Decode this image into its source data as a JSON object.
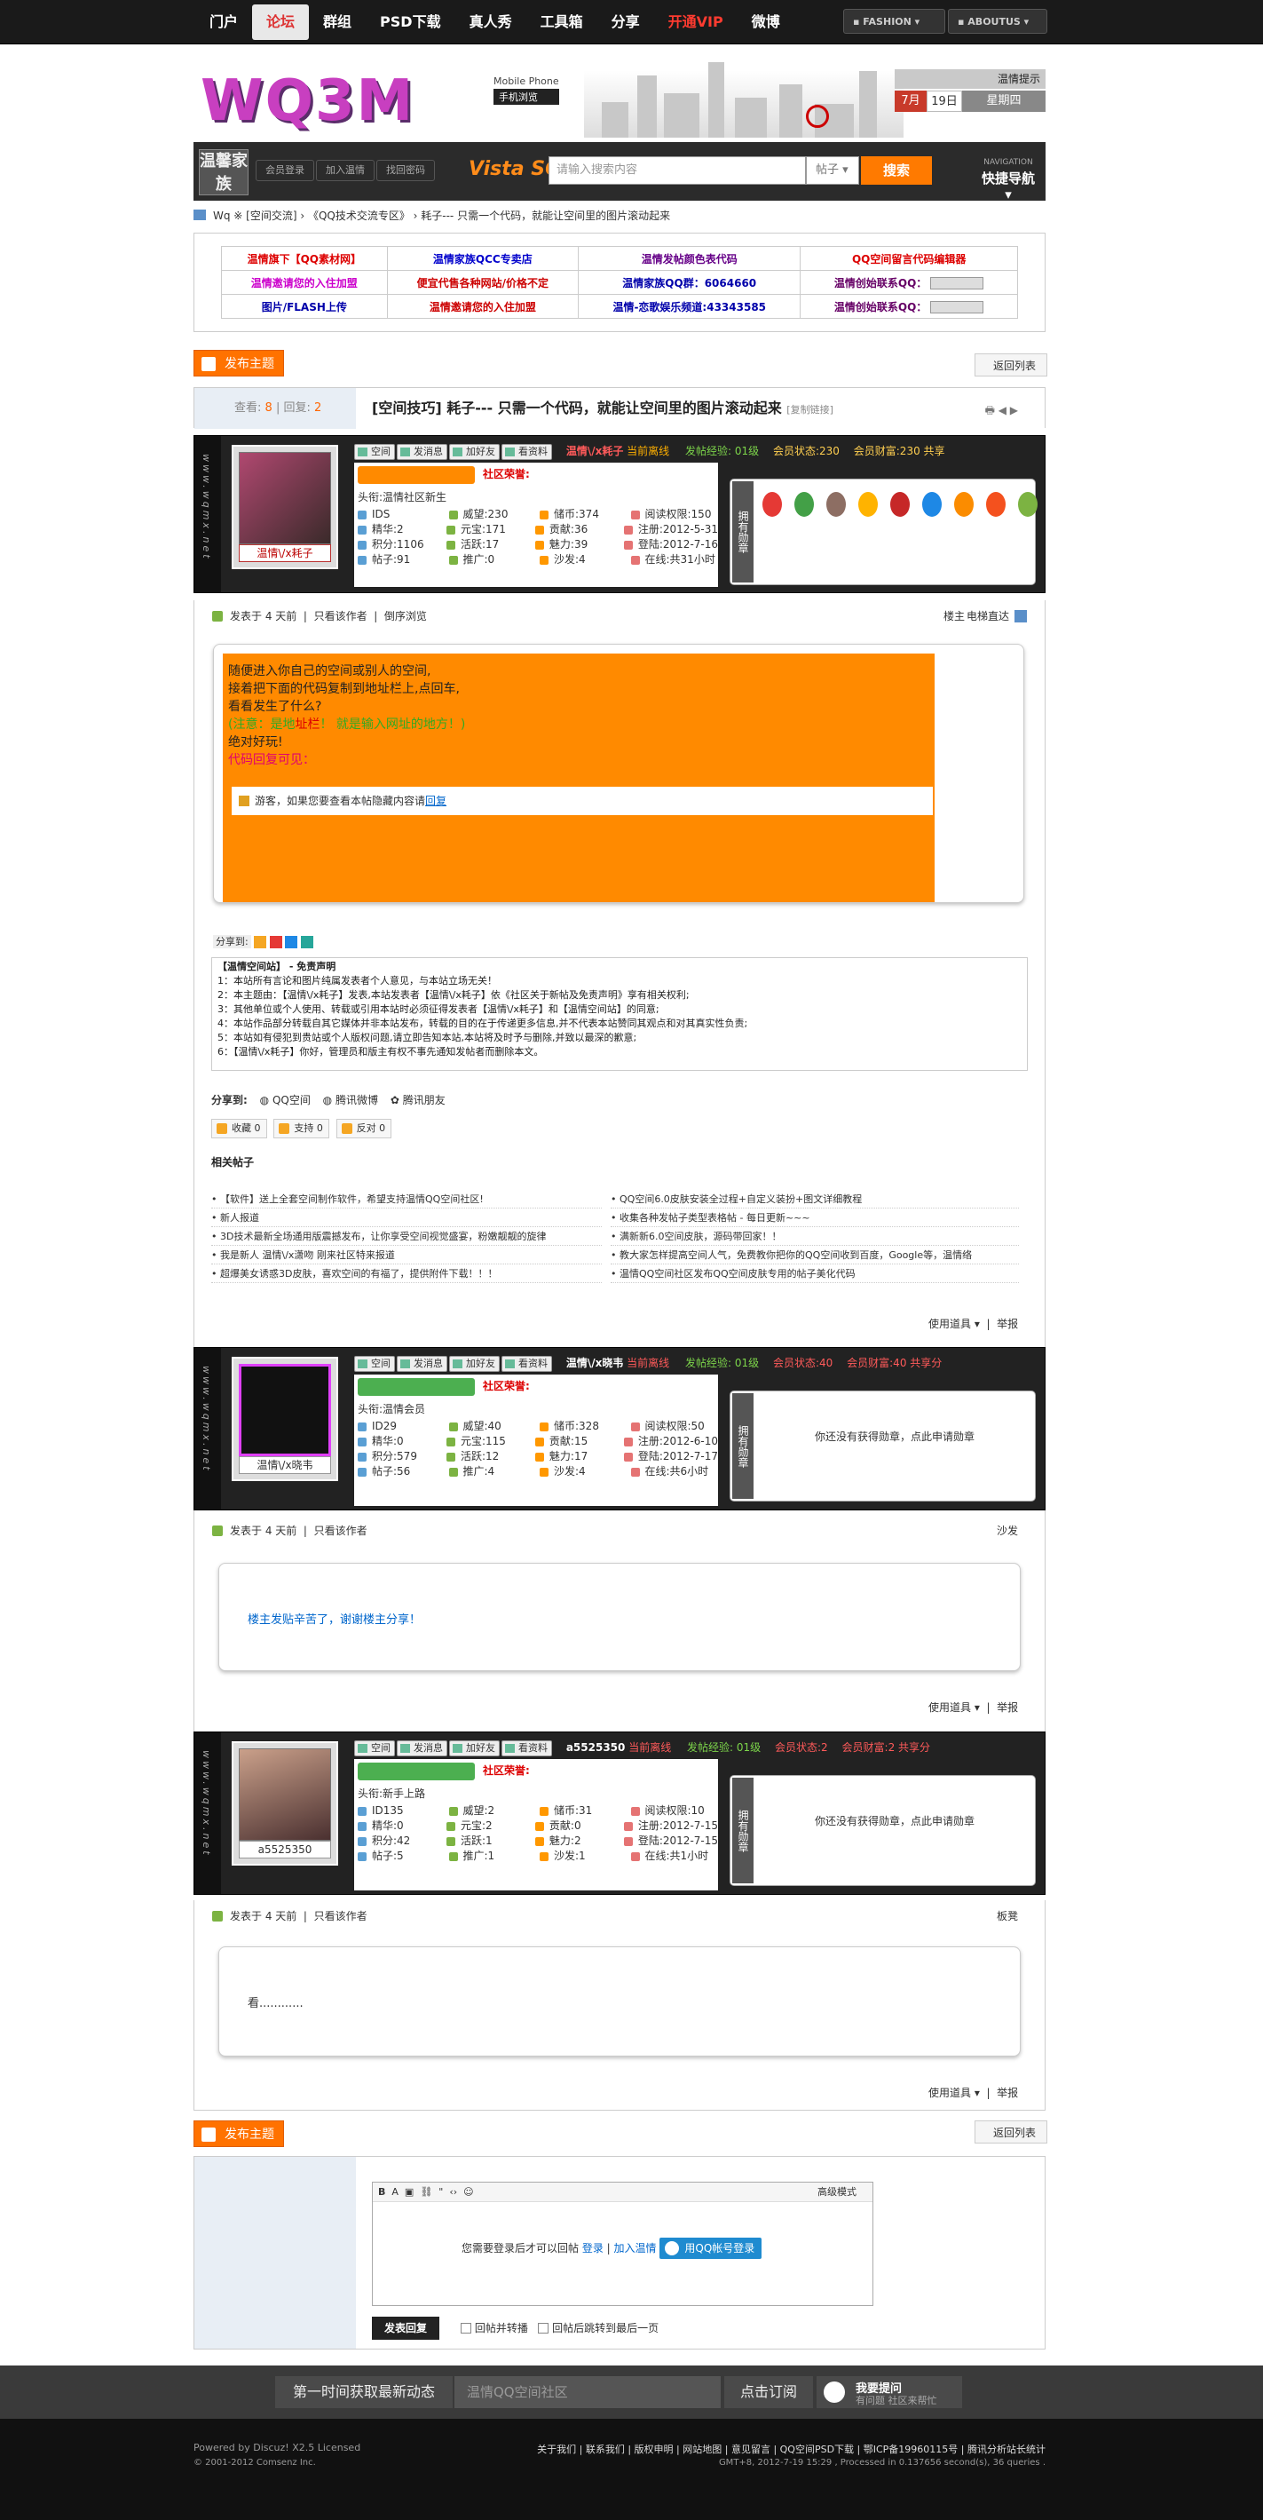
{
  "topnav": {
    "items": [
      "门户",
      "论坛",
      "群组",
      "PSD下载",
      "真人秀",
      "工具箱",
      "分享",
      "开通VIP",
      "微博"
    ],
    "fashion": "FASHION",
    "aboutus": "ABOUTUS"
  },
  "header": {
    "logo": "WQ3M",
    "mobile_en": "Mobile Phone",
    "mobile_cn": "手机浏览",
    "welcome": "温情提示",
    "month": "7月",
    "day": "19日",
    "weekday": "星期四"
  },
  "searchbar": {
    "avatar_text": "温馨家族",
    "login": "会员登录",
    "join": "加入温情",
    "recover": "找回密码",
    "brand": "Vista SO",
    "placeholder": "请输入搜索内容",
    "select": "帖子",
    "go": "搜索",
    "nav_en": "NAVIGATION",
    "nav_cn": "快捷导航"
  },
  "breadcrumb": "Wq ※ [空间交流] › 《QQ技术交流专区》 › 耗子--- 只需一个代码，就能让空间里的图片滚动起来",
  "ads": [
    [
      "温情旗下【QQ素材网】",
      "温情家族QCC专卖店",
      "温情发帖颜色表代码",
      "QQ空间留言代码编辑器"
    ],
    [
      "温情邀请您的入住加盟",
      "便宜代售各种网站/价格不定",
      "温情家族QQ群：6064660",
      "温情创始联系QQ："
    ],
    [
      "图片/FLASH上传",
      "温情邀请您的入住加盟",
      "温情-恋歌娱乐频道:43343585",
      "温情创始联系QQ："
    ]
  ],
  "actions": {
    "new_post": "发布主题",
    "back": "返回列表"
  },
  "thread": {
    "views_label": "查看:",
    "views": "8",
    "replies_label": "回复:",
    "replies": "2",
    "title": "[空间技巧] 耗子--- 只需一个代码，就能让空间里的图片滚动起来",
    "copy": "[复制链接]"
  },
  "side_text": "www.wqmx.net",
  "posts": [
    {
      "name": "温情\\/x耗子",
      "status": "当前离线",
      "exp": "发帖经验: 01级",
      "mstate": "会员状态:230",
      "wealth": "会员财富:230 共享",
      "honor": "社区荣誉:",
      "title": "头衔:温情社区新生",
      "stats": [
        [
          "IDS",
          "威望:230",
          "储币:374",
          "阅读权限:150"
        ],
        [
          "精华:2",
          "元宝:171",
          "贡献:36",
          "注册:2012-5-31"
        ],
        [
          "积分:1106",
          "活跃:17",
          "魅力:39",
          "登陆:2012-7-16"
        ],
        [
          "帖子:91",
          "推广:0",
          "沙发:4",
          "在线:共31小时"
        ]
      ],
      "posted": "发表于  4 天前",
      "only": "只看该作者",
      "order": "倒序浏览",
      "floor": "楼主",
      "elevator": "电梯直达"
    },
    {
      "name": "温情\\/x晓韦",
      "status": "当前离线",
      "exp": "发帖经验: 01级",
      "mstate": "会员状态:40",
      "wealth": "会员财富:40 共享分",
      "honor": "社区荣誉:",
      "title": "头衔:温情会员",
      "stats": [
        [
          "ID29",
          "威望:40",
          "储币:328",
          "阅读权限:50"
        ],
        [
          "精华:0",
          "元宝:115",
          "贡献:15",
          "注册:2012-6-10"
        ],
        [
          "积分:579",
          "活跃:12",
          "魅力:17",
          "登陆:2012-7-17"
        ],
        [
          "帖子:56",
          "推广:4",
          "沙发:4",
          "在线:共6小时"
        ]
      ],
      "posted": "发表于  4 天前",
      "only": "只看该作者",
      "floor": "沙发",
      "medal_empty": "你还没有获得勋章，点此申请勋章",
      "reply": "楼主发贴辛苦了，谢谢楼主分享！"
    },
    {
      "name": "a5525350",
      "status": "当前离线",
      "exp": "发帖经验: 01级",
      "mstate": "会员状态:2",
      "wealth": "会员财富:2 共享分",
      "honor": "社区荣誉:",
      "title": "头衔:新手上路",
      "stats": [
        [
          "ID135",
          "威望:2",
          "储币:31",
          "阅读权限:10"
        ],
        [
          "精华:0",
          "元宝:2",
          "贡献:0",
          "注册:2012-7-15"
        ],
        [
          "积分:42",
          "活跃:1",
          "魅力:2",
          "登陆:2012-7-15"
        ],
        [
          "帖子:5",
          "推广:1",
          "沙发:1",
          "在线:共1小时"
        ]
      ],
      "posted": "发表于  4 天前",
      "only": "只看该作者",
      "floor": "板凳",
      "medal_empty": "你还没有获得勋章，点此申请勋章",
      "reply": "看............"
    }
  ],
  "content": {
    "l1": "随便进入你自己的空间或别人的空间,",
    "l2": "接着把下面的代码复制到地址栏上,点回车,",
    "l3": " 看看发生了什么?",
    "l4a": "(注意：是地",
    "l4b": "址栏",
    "l4c": "！  就是输入网址的地方！)",
    "l5": "绝对好玩!",
    "l6": "代码回复可见：",
    "hidden": "游客，如果您要查看本帖隐藏内容请",
    "hidden_link": "回复"
  },
  "share_label": "分享到:",
  "disclaimer": {
    "head": "【温情空间站】 - 免责声明",
    "lines": [
      "1：本站所有言论和图片纯属发表者个人意见，与本站立场无关！",
      "2：本主题由：【温情\\/x耗子】发表,本站发表者【温情\\/x耗子】依《社区关于新帖及免责声明》享有相关权利;",
      "3：其他单位或个人使用、转载或引用本站时必须征得发表者【温情\\/x耗子】和【温情空间站】的同意;",
      "4：本站作品部分转载自其它媒体并非本站发布，转载的目的在于传递更多信息,并不代表本站赞同其观点和对其真实性负责;",
      "5：本站如有侵犯到贵站或个人版权问题,请立即告知本站,本站将及时予与删除,并致以最深的歉意;",
      "6：【温情\\/x耗子】你好，管理员和版主有权不事先通知发帖者而删除本文。"
    ]
  },
  "share": {
    "label": "分享到:",
    "qzone": "QQ空间",
    "weibo": "腾讯微博",
    "friends": "腾讯朋友"
  },
  "votes": {
    "fav": "收藏",
    "fav_n": "0",
    "support": "支持",
    "support_n": "0",
    "oppose": "反对",
    "oppose_n": "0"
  },
  "related": {
    "title": "相关帖子",
    "left": [
      "【软件】送上全套空间制作软件，希望支持温情QQ空间社区!",
      "新人报道",
      "3D技术最新全场通用版震撼发布，让你享受空间视觉盛宴，粉嫩靓靓的旋律",
      "我是新人 温情\\/x潇吻 刚来社区特来报道",
      "超爆美女诱惑3D皮肤，喜欢空间的有福了，提供附件下载！！！"
    ],
    "right": [
      "QQ空间6.0皮肤安装全过程+自定义装扮+图文详细教程",
      "收集各种发帖子类型表格帖 - 每日更新~~~",
      "满新新6.0空间皮肤，源码带回家！！",
      "教大家怎样提高空间人气，免费教你把你的QQ空间收到百度，Google等，温情络",
      "温情QQ空间社区发布QQ空间皮肤专用的帖子美化代码"
    ]
  },
  "post_opts": {
    "tools": "使用道具",
    "report": "举报"
  },
  "reply_form": {
    "mode": "高级模式",
    "need_login": "您需要登录后才可以回帖",
    "login": "登录",
    "join": "加入温情",
    "qq_login": "用QQ帐号登录",
    "submit": "发表回复",
    "opt1": "回帖并转播",
    "opt2": "回帖后跳转到最后一页"
  },
  "footer": {
    "subscribe_label": "第一时间获取最新动态",
    "subscribe_placeholder": "温情QQ空间社区",
    "subscribe_btn": "点击订阅",
    "ask": "我要提问",
    "ask_sub": "有问题 社区来帮忙",
    "powered": "Powered by Discuz! X2.5 Licensed",
    "copy": "© 2001-2012 Comsenz Inc.",
    "links": "关于我们 | 联系我们 | 版权申明 | 网站地图 | 意见留言 | QQ空间PSD下载 | 鄂ICP备19960115号 |  腾讯分析站长统计",
    "gmt": "GMT+8, 2012-7-19 15:29 , Processed in 0.137656 second(s), 36 queries ."
  }
}
